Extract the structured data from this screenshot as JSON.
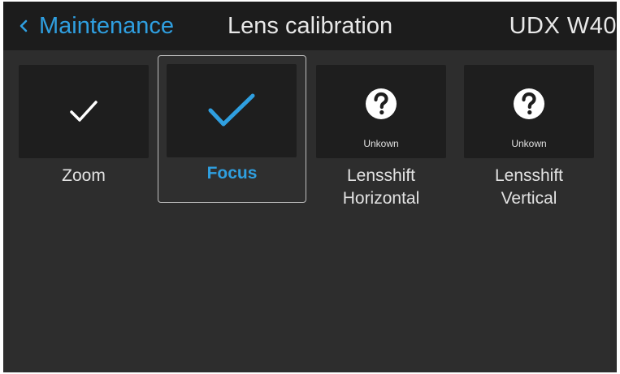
{
  "header": {
    "back_label": "Maintenance",
    "title": "Lens calibration",
    "model": "UDX W40"
  },
  "items": [
    {
      "label": "Zoom",
      "icon": "checkmark-icon",
      "status": "",
      "selected": false
    },
    {
      "label": "Focus",
      "icon": "checkmark-icon",
      "status": "",
      "selected": true
    },
    {
      "label_line1": "Lensshift",
      "label_line2": "Horizontal",
      "icon": "question-icon",
      "status": "Unkown",
      "selected": false
    },
    {
      "label_line1": "Lensshift",
      "label_line2": "Vertical",
      "icon": "question-icon",
      "status": "Unkown",
      "selected": false
    }
  ],
  "colors": {
    "accent": "#2f9fe0",
    "background": "#2d2d2d",
    "header": "#1c1c1c",
    "tile": "#1e1e1e"
  }
}
